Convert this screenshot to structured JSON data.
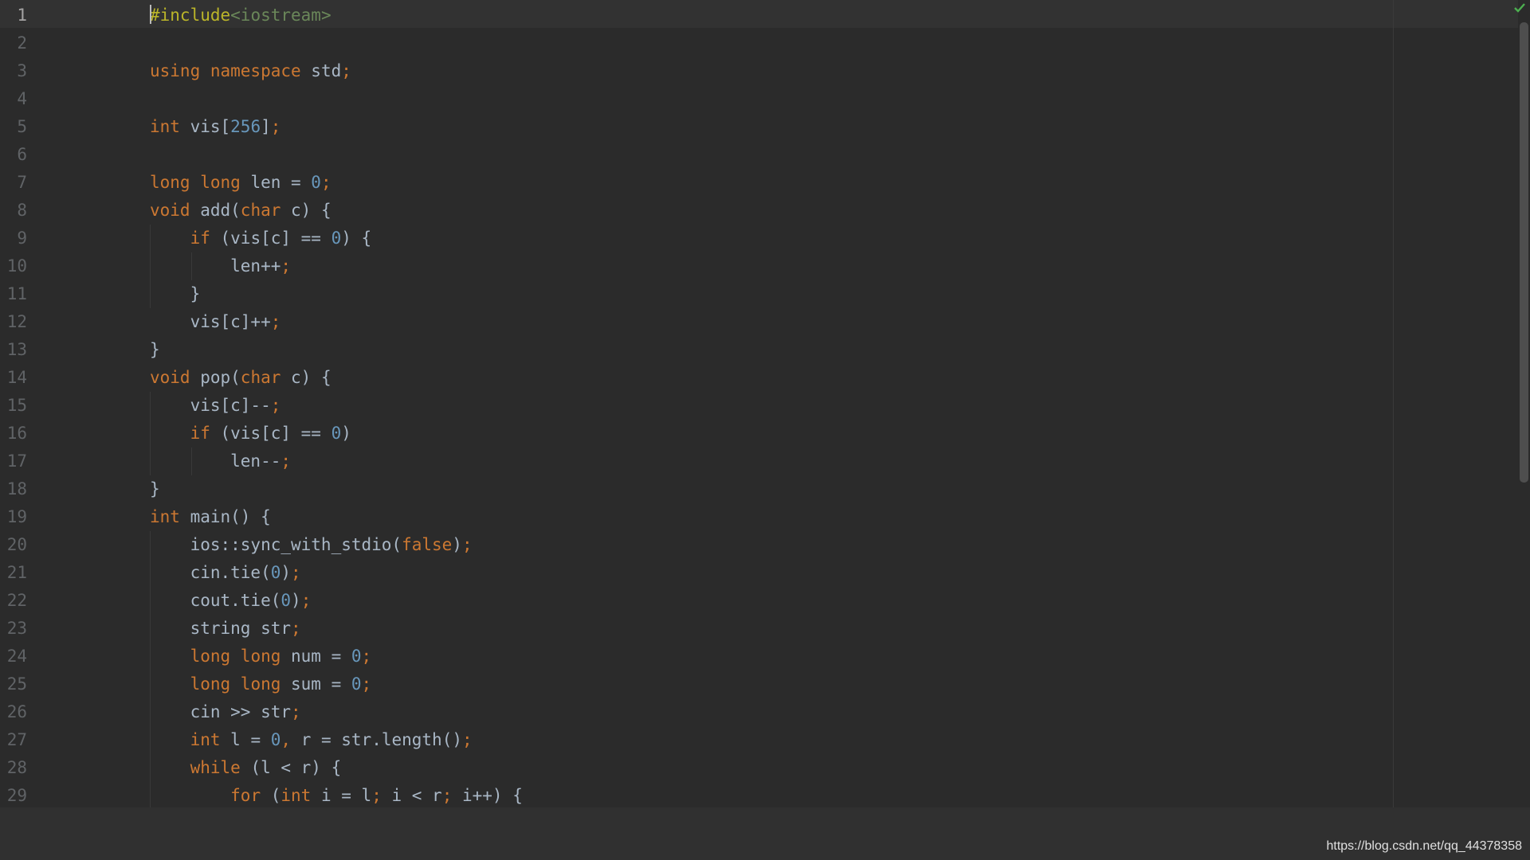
{
  "editor": {
    "language": "cpp",
    "current_line": 1,
    "lines": [
      {
        "n": "1",
        "tokens": [
          [
            "pp",
            "#include"
          ],
          [
            "hdr",
            "<iostream>"
          ]
        ]
      },
      {
        "n": "2",
        "tokens": []
      },
      {
        "n": "3",
        "tokens": [
          [
            "kw",
            "using "
          ],
          [
            "kw",
            "namespace "
          ],
          [
            "plain",
            "std"
          ],
          [
            "punct",
            ";"
          ]
        ]
      },
      {
        "n": "4",
        "tokens": []
      },
      {
        "n": "5",
        "tokens": [
          [
            "kw",
            "int "
          ],
          [
            "plain",
            "vis["
          ],
          [
            "num",
            "256"
          ],
          [
            "plain",
            "]"
          ],
          [
            "punct",
            ";"
          ]
        ]
      },
      {
        "n": "6",
        "tokens": []
      },
      {
        "n": "7",
        "tokens": [
          [
            "kw",
            "long "
          ],
          [
            "kw",
            "long "
          ],
          [
            "plain",
            "len = "
          ],
          [
            "num",
            "0"
          ],
          [
            "punct",
            ";"
          ]
        ]
      },
      {
        "n": "8",
        "tokens": [
          [
            "kw",
            "void "
          ],
          [
            "plain",
            "add("
          ],
          [
            "kw",
            "char "
          ],
          [
            "plain",
            "c) {"
          ]
        ]
      },
      {
        "n": "9",
        "tokens": [
          [
            "plain",
            "    "
          ],
          [
            "kw",
            "if "
          ],
          [
            "plain",
            "(vis[c] == "
          ],
          [
            "num",
            "0"
          ],
          [
            "plain",
            ") {"
          ]
        ]
      },
      {
        "n": "10",
        "tokens": [
          [
            "plain",
            "        len++"
          ],
          [
            "punct",
            ";"
          ]
        ]
      },
      {
        "n": "11",
        "tokens": [
          [
            "plain",
            "    }"
          ]
        ]
      },
      {
        "n": "12",
        "tokens": [
          [
            "plain",
            "    vis[c]++"
          ],
          [
            "punct",
            ";"
          ]
        ]
      },
      {
        "n": "13",
        "tokens": [
          [
            "plain",
            "}"
          ]
        ]
      },
      {
        "n": "14",
        "tokens": [
          [
            "kw",
            "void "
          ],
          [
            "plain",
            "pop("
          ],
          [
            "kw",
            "char "
          ],
          [
            "plain",
            "c) {"
          ]
        ]
      },
      {
        "n": "15",
        "tokens": [
          [
            "plain",
            "    vis[c]--"
          ],
          [
            "punct",
            ";"
          ]
        ]
      },
      {
        "n": "16",
        "tokens": [
          [
            "plain",
            "    "
          ],
          [
            "kw",
            "if "
          ],
          [
            "plain",
            "(vis[c] == "
          ],
          [
            "num",
            "0"
          ],
          [
            "plain",
            ")"
          ]
        ]
      },
      {
        "n": "17",
        "tokens": [
          [
            "plain",
            "        len--"
          ],
          [
            "punct",
            ";"
          ]
        ]
      },
      {
        "n": "18",
        "tokens": [
          [
            "plain",
            "}"
          ]
        ]
      },
      {
        "n": "19",
        "tokens": [
          [
            "kw",
            "int "
          ],
          [
            "plain",
            "main() {"
          ]
        ]
      },
      {
        "n": "20",
        "tokens": [
          [
            "plain",
            "    ios::sync_with_stdio("
          ],
          [
            "kw",
            "false"
          ],
          [
            "plain",
            ")"
          ],
          [
            "punct",
            ";"
          ]
        ]
      },
      {
        "n": "21",
        "tokens": [
          [
            "plain",
            "    cin.tie("
          ],
          [
            "num",
            "0"
          ],
          [
            "plain",
            ")"
          ],
          [
            "punct",
            ";"
          ]
        ]
      },
      {
        "n": "22",
        "tokens": [
          [
            "plain",
            "    cout.tie("
          ],
          [
            "num",
            "0"
          ],
          [
            "plain",
            ")"
          ],
          [
            "punct",
            ";"
          ]
        ]
      },
      {
        "n": "23",
        "tokens": [
          [
            "plain",
            "    string str"
          ],
          [
            "punct",
            ";"
          ]
        ]
      },
      {
        "n": "24",
        "tokens": [
          [
            "plain",
            "    "
          ],
          [
            "kw",
            "long "
          ],
          [
            "kw",
            "long "
          ],
          [
            "plain",
            "num = "
          ],
          [
            "num",
            "0"
          ],
          [
            "punct",
            ";"
          ]
        ]
      },
      {
        "n": "25",
        "tokens": [
          [
            "plain",
            "    "
          ],
          [
            "kw",
            "long "
          ],
          [
            "kw",
            "long "
          ],
          [
            "plain",
            "sum = "
          ],
          [
            "num",
            "0"
          ],
          [
            "punct",
            ";"
          ]
        ]
      },
      {
        "n": "26",
        "tokens": [
          [
            "plain",
            "    cin >> str"
          ],
          [
            "punct",
            ";"
          ]
        ]
      },
      {
        "n": "27",
        "tokens": [
          [
            "plain",
            "    "
          ],
          [
            "kw",
            "int "
          ],
          [
            "plain",
            "l = "
          ],
          [
            "num",
            "0"
          ],
          [
            "punct",
            ", "
          ],
          [
            "plain",
            "r = str.length()"
          ],
          [
            "punct",
            ";"
          ]
        ]
      },
      {
        "n": "28",
        "tokens": [
          [
            "plain",
            "    "
          ],
          [
            "kw",
            "while "
          ],
          [
            "plain",
            "(l < r) {"
          ]
        ]
      },
      {
        "n": "29",
        "tokens": [
          [
            "plain",
            "        "
          ],
          [
            "kw",
            "for "
          ],
          [
            "plain",
            "("
          ],
          [
            "kw",
            "int "
          ],
          [
            "plain",
            "i = l"
          ],
          [
            "punct",
            "; "
          ],
          [
            "plain",
            "i < r"
          ],
          [
            "punct",
            "; "
          ],
          [
            "plain",
            "i++) {"
          ]
        ]
      }
    ]
  },
  "status": {
    "inspection": "check-icon"
  },
  "watermark": "https://blog.csdn.net/qq_44378358"
}
